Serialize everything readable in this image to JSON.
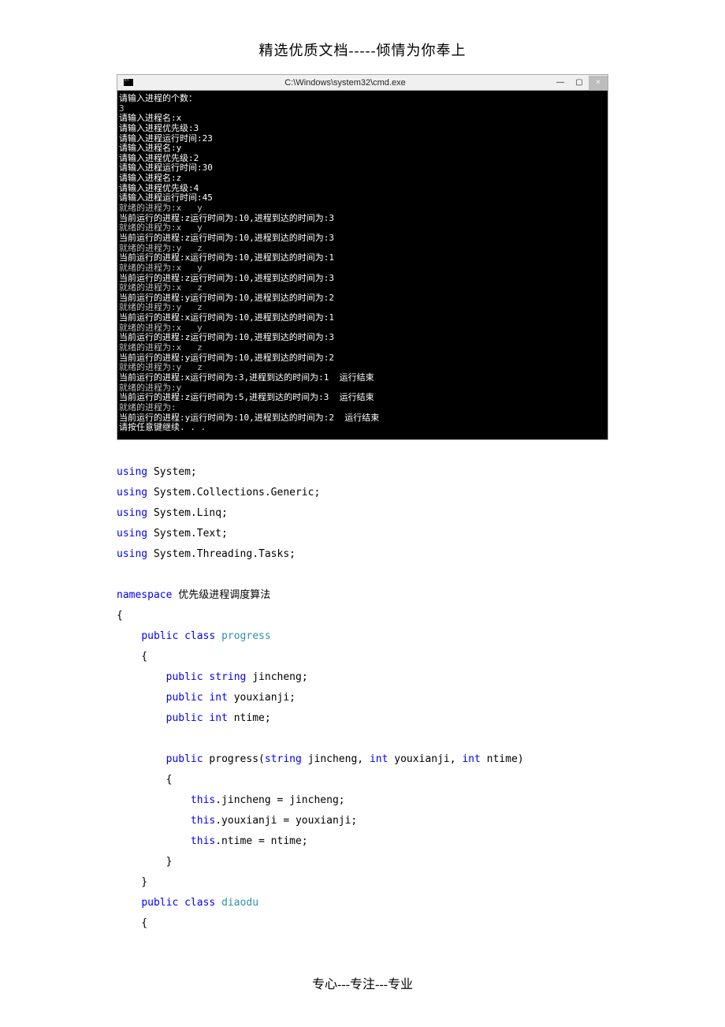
{
  "doc_header": "精选优质文档-----倾情为你奉上",
  "doc_footer": "专心---专注---专业",
  "window": {
    "title": "C:\\Windows\\system32\\cmd.exe",
    "min_glyph": "—",
    "max_glyph": "▢",
    "close_glyph": "×"
  },
  "terminal_lines": [
    {
      "t": "请输入进程的个数：",
      "hl": true
    },
    {
      "t": "3",
      "hl": false
    },
    {
      "t": "请输入进程名:x",
      "hl": true
    },
    {
      "t": "请输入进程优先级:3",
      "hl": true
    },
    {
      "t": "请输入进程运行时间:23",
      "hl": true
    },
    {
      "t": "请输入进程名:y",
      "hl": true
    },
    {
      "t": "请输入进程优先级:2",
      "hl": true
    },
    {
      "t": "请输入进程运行时间:30",
      "hl": true
    },
    {
      "t": "请输入进程名:z",
      "hl": true
    },
    {
      "t": "请输入进程优先级:4",
      "hl": true
    },
    {
      "t": "请输入进程运行时间:45",
      "hl": true
    },
    {
      "t": "就绪的进程为:x   y",
      "hl": false
    },
    {
      "t": "当前运行的进程:z运行时间为:10,进程到达的时间为:3",
      "hl": true
    },
    {
      "t": "就绪的进程为:x   y",
      "hl": false
    },
    {
      "t": "当前运行的进程:z运行时间为:10,进程到达的时间为:3",
      "hl": true
    },
    {
      "t": "就绪的进程为:y   z",
      "hl": false
    },
    {
      "t": "当前运行的进程:x运行时间为:10,进程到达的时间为:1",
      "hl": true
    },
    {
      "t": "就绪的进程为:x   y",
      "hl": false
    },
    {
      "t": "当前运行的进程:z运行时间为:10,进程到达的时间为:3",
      "hl": true
    },
    {
      "t": "就绪的进程为:x   z",
      "hl": false
    },
    {
      "t": "当前运行的进程:y运行时间为:10,进程到达的时间为:2",
      "hl": true
    },
    {
      "t": "就绪的进程为:y   z",
      "hl": false
    },
    {
      "t": "当前运行的进程:x运行时间为:10,进程到达的时间为:1",
      "hl": true
    },
    {
      "t": "就绪的进程为:x   y",
      "hl": false
    },
    {
      "t": "当前运行的进程:z运行时间为:10,进程到达的时间为:3",
      "hl": true
    },
    {
      "t": "就绪的进程为:x   z",
      "hl": false
    },
    {
      "t": "当前运行的进程:y运行时间为:10,进程到达的时间为:2",
      "hl": true
    },
    {
      "t": "就绪的进程为:y   z",
      "hl": false
    },
    {
      "t": "当前运行的进程:x运行时间为:3,进程到达的时间为:1  运行结束",
      "hl": true
    },
    {
      "t": "就绪的进程为:y",
      "hl": false
    },
    {
      "t": "当前运行的进程:z运行时间为:5,进程到达的时间为:3  运行结束",
      "hl": true
    },
    {
      "t": "就绪的进程为:",
      "hl": false
    },
    {
      "t": "当前运行的进程:y运行时间为:10,进程到达的时间为:2  运行结束",
      "hl": true
    },
    {
      "t": "请按任意键继续. . .",
      "hl": true
    }
  ],
  "code_tokens": [
    [
      {
        "c": "kw",
        "t": "using"
      },
      {
        "t": " System;"
      }
    ],
    [
      {
        "c": "kw",
        "t": "using"
      },
      {
        "t": " System.Collections.Generic;"
      }
    ],
    [
      {
        "c": "kw",
        "t": "using"
      },
      {
        "t": " System.Linq;"
      }
    ],
    [
      {
        "c": "kw",
        "t": "using"
      },
      {
        "t": " System.Text;"
      }
    ],
    [
      {
        "c": "kw",
        "t": "using"
      },
      {
        "t": " System.Threading.Tasks;"
      }
    ],
    [],
    [
      {
        "c": "kw",
        "t": "namespace"
      },
      {
        "t": " 优先级进程调度算法"
      }
    ],
    [
      {
        "t": "{"
      }
    ],
    [
      {
        "t": "    "
      },
      {
        "c": "kw",
        "t": "public"
      },
      {
        "t": " "
      },
      {
        "c": "kw",
        "t": "class"
      },
      {
        "t": " "
      },
      {
        "c": "cls",
        "t": "progress"
      }
    ],
    [
      {
        "t": "    {"
      }
    ],
    [
      {
        "t": "        "
      },
      {
        "c": "kw",
        "t": "public"
      },
      {
        "t": " "
      },
      {
        "c": "kw",
        "t": "string"
      },
      {
        "t": " jincheng;"
      }
    ],
    [
      {
        "t": "        "
      },
      {
        "c": "kw",
        "t": "public"
      },
      {
        "t": " "
      },
      {
        "c": "kw",
        "t": "int"
      },
      {
        "t": " youxianji;"
      }
    ],
    [
      {
        "t": "        "
      },
      {
        "c": "kw",
        "t": "public"
      },
      {
        "t": " "
      },
      {
        "c": "kw",
        "t": "int"
      },
      {
        "t": " ntime;"
      }
    ],
    [],
    [
      {
        "t": "        "
      },
      {
        "c": "kw",
        "t": "public"
      },
      {
        "t": " progress("
      },
      {
        "c": "kw",
        "t": "string"
      },
      {
        "t": " jincheng, "
      },
      {
        "c": "kw",
        "t": "int"
      },
      {
        "t": " youxianji, "
      },
      {
        "c": "kw",
        "t": "int"
      },
      {
        "t": " ntime)"
      }
    ],
    [
      {
        "t": "        {"
      }
    ],
    [
      {
        "t": "            "
      },
      {
        "c": "kw",
        "t": "this"
      },
      {
        "t": ".jincheng = jincheng;"
      }
    ],
    [
      {
        "t": "            "
      },
      {
        "c": "kw",
        "t": "this"
      },
      {
        "t": ".youxianji = youxianji;"
      }
    ],
    [
      {
        "t": "            "
      },
      {
        "c": "kw",
        "t": "this"
      },
      {
        "t": ".ntime = ntime;"
      }
    ],
    [
      {
        "t": "        }"
      }
    ],
    [
      {
        "t": "    }"
      }
    ],
    [
      {
        "t": "    "
      },
      {
        "c": "kw",
        "t": "public"
      },
      {
        "t": " "
      },
      {
        "c": "kw",
        "t": "class"
      },
      {
        "t": " "
      },
      {
        "c": "cls",
        "t": "diaodu"
      }
    ],
    [
      {
        "t": "    {"
      }
    ]
  ]
}
